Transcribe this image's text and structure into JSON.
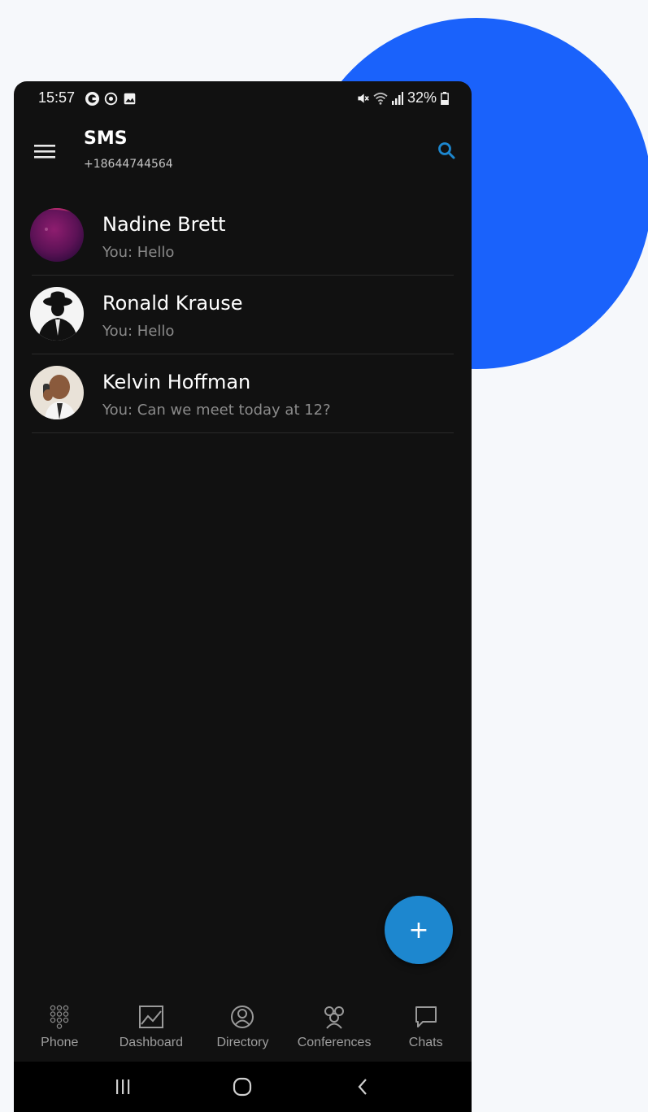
{
  "status_bar": {
    "time": "15:57",
    "battery": "32%"
  },
  "app_bar": {
    "title": "SMS",
    "subtitle": "+18644744564"
  },
  "conversations": [
    {
      "name": "Nadine Brett",
      "preview": "You: Hello"
    },
    {
      "name": "Ronald Krause",
      "preview": "You: Hello"
    },
    {
      "name": "Kelvin Hoffman",
      "preview": "You: Can we meet today at 12?"
    }
  ],
  "fab": {
    "label": "+"
  },
  "bottom_nav": [
    {
      "label": "Phone",
      "icon": "dialpad-icon"
    },
    {
      "label": "Dashboard",
      "icon": "chart-icon"
    },
    {
      "label": "Directory",
      "icon": "contact-icon"
    },
    {
      "label": "Conferences",
      "icon": "group-icon"
    },
    {
      "label": "Chats",
      "icon": "chat-bubble-icon"
    }
  ],
  "colors": {
    "accent": "#1d87cf",
    "background_blob": "#1a62fb",
    "screen_bg": "#111111",
    "page_bg": "#f6f8fb"
  }
}
